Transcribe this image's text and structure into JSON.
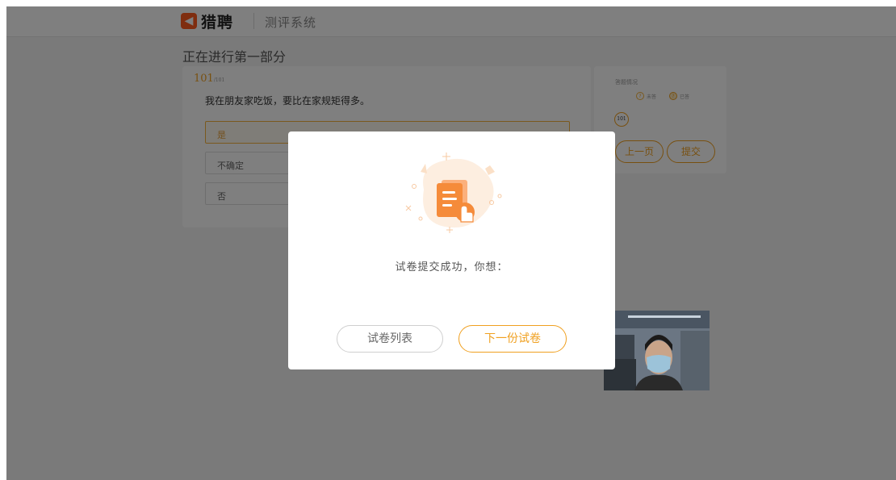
{
  "header": {
    "logo_text": "猎聘",
    "logo_mark_glyph": "◀",
    "system_title": "测评系统"
  },
  "section_title": "正在进行第一部分",
  "question": {
    "number": "101",
    "total": "/101",
    "text": "我在朋友家吃饭，要比在家规矩得多。",
    "options": [
      {
        "label": "是",
        "selected": true
      },
      {
        "label": "不确定",
        "selected": false
      },
      {
        "label": "否",
        "selected": false
      }
    ]
  },
  "status_panel": {
    "title": "答题情况",
    "legend": [
      {
        "symbol": "?",
        "label": "未答"
      },
      {
        "symbol": "?",
        "label": "已答"
      }
    ],
    "answered_items": [
      "101"
    ],
    "prev_label": "上一页",
    "submit_label": "提交"
  },
  "modal": {
    "icon": "document-touch-icon",
    "message": "试卷提交成功，你想：",
    "list_button": "试卷列表",
    "next_button": "下一份试卷"
  },
  "colors": {
    "accent": "#f0a020",
    "brand": "#ff5a1f",
    "overlay": "rgba(0,0,0,0.5)"
  }
}
